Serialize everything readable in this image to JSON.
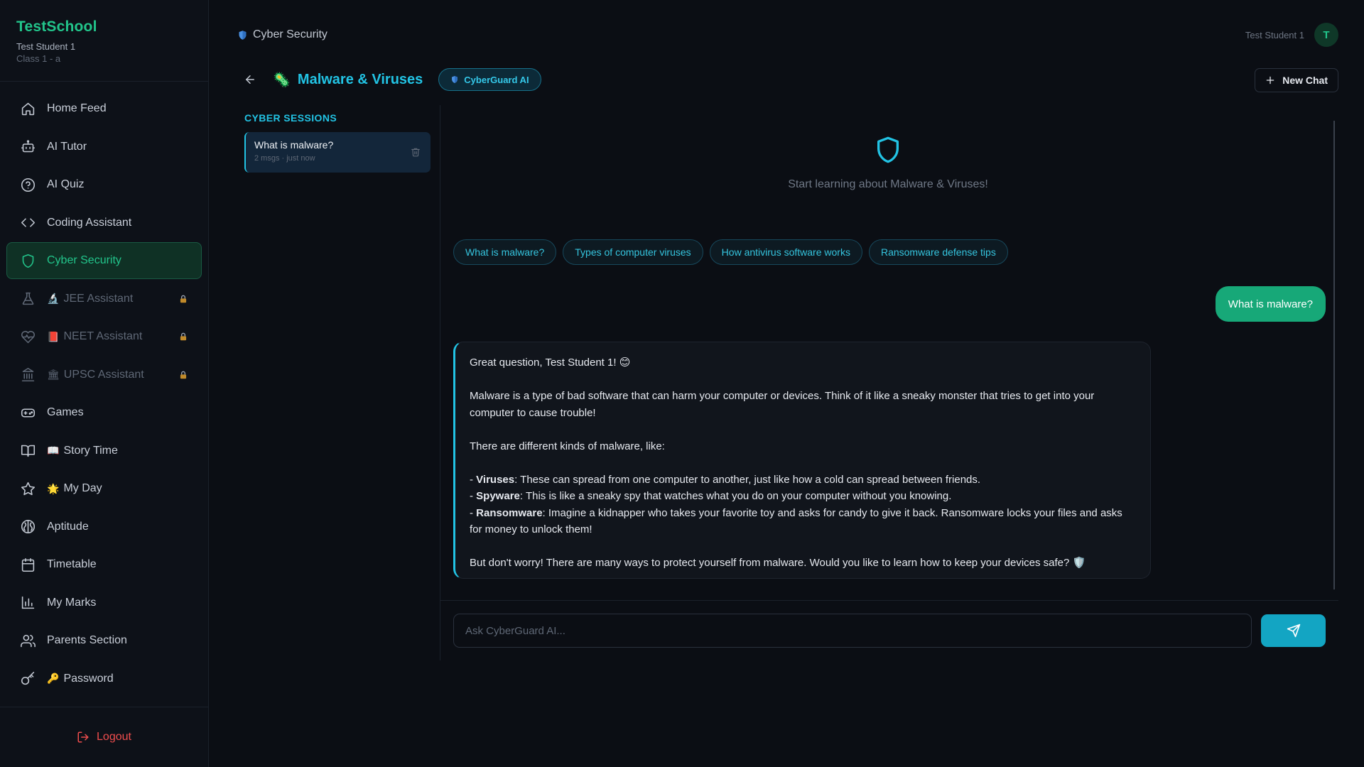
{
  "brand": {
    "name": "TestSchool",
    "user": "Test Student 1",
    "class": "Class 1 - a"
  },
  "sidebar": {
    "items": [
      {
        "label": "Home Feed",
        "emoji": "",
        "icon": "home-icon",
        "active": false,
        "locked": false
      },
      {
        "label": "AI Tutor",
        "emoji": "",
        "icon": "robot-icon",
        "active": false,
        "locked": false
      },
      {
        "label": "AI Quiz",
        "emoji": "",
        "icon": "help-circle-icon",
        "active": false,
        "locked": false
      },
      {
        "label": "Coding Assistant",
        "emoji": "",
        "icon": "code-icon",
        "active": false,
        "locked": false
      },
      {
        "label": "Cyber Security",
        "emoji": "",
        "icon": "shield-icon",
        "active": true,
        "locked": false
      },
      {
        "label": "JEE Assistant",
        "emoji": "🔬",
        "icon": "flask-icon",
        "active": false,
        "locked": true
      },
      {
        "label": "NEET Assistant",
        "emoji": "📕",
        "icon": "heart-pulse-icon",
        "active": false,
        "locked": true
      },
      {
        "label": "UPSC Assistant",
        "emoji": "🏛",
        "icon": "landmark-icon",
        "active": false,
        "locked": true
      },
      {
        "label": "Games",
        "emoji": "",
        "icon": "gamepad-icon",
        "active": false,
        "locked": false
      },
      {
        "label": "Story Time",
        "emoji": "📖",
        "icon": "book-icon",
        "active": false,
        "locked": false
      },
      {
        "label": "My Day",
        "emoji": "🌟",
        "icon": "star-icon",
        "active": false,
        "locked": false
      },
      {
        "label": "Aptitude",
        "emoji": "",
        "icon": "brain-icon",
        "active": false,
        "locked": false
      },
      {
        "label": "Timetable",
        "emoji": "",
        "icon": "calendar-icon",
        "active": false,
        "locked": false
      },
      {
        "label": "My Marks",
        "emoji": "",
        "icon": "bar-chart-icon",
        "active": false,
        "locked": false
      },
      {
        "label": "Parents Section",
        "emoji": "",
        "icon": "users-icon",
        "active": false,
        "locked": false
      },
      {
        "label": "Password",
        "emoji": "🔑",
        "icon": "key-icon",
        "active": false,
        "locked": false
      }
    ],
    "logout_label": "Logout"
  },
  "header": {
    "breadcrumb": "Cyber Security",
    "user_name": "Test Student 1",
    "avatar_initial": "T",
    "topic_emoji": "🦠",
    "topic_title": "Malware & Viruses",
    "ai_badge": "CyberGuard AI",
    "new_chat_label": "New Chat"
  },
  "sessions": {
    "title": "CYBER SESSIONS",
    "items": [
      {
        "title": "What is malware?",
        "meta": "2 msgs · just now"
      }
    ]
  },
  "chat": {
    "empty_text": "Start learning about Malware & Viruses!",
    "suggestions": [
      "What is malware?",
      "Types of computer viruses",
      "How antivirus software works",
      "Ransomware defense tips"
    ],
    "user_message": "What is malware?",
    "ai_message": {
      "greeting": "Great question, Test Student 1! 😊",
      "para1": "Malware is a type of bad software that can harm your computer or devices. Think of it like a sneaky monster that tries to get into your computer to cause trouble!",
      "para2": "There are different kinds of malware, like:",
      "bullets": [
        {
          "term": "Viruses",
          "text": ": These can spread from one computer to another, just like how a cold can spread between friends."
        },
        {
          "term": "Spyware",
          "text": ": This is like a sneaky spy that watches what you do on your computer without you knowing."
        },
        {
          "term": "Ransomware",
          "text": ": Imagine a kidnapper who takes your favorite toy and asks for candy to give it back. Ransomware locks your files and asks for money to unlock them!"
        }
      ],
      "closing": "But don't worry! There are many ways to protect yourself from malware. Would you like to learn how to keep your devices safe? 🛡️"
    },
    "input_placeholder": "Ask CyberGuard AI..."
  },
  "colors": {
    "brand_green": "#22c58b",
    "accent_cyan": "#22c3e4",
    "danger": "#ef4d4d",
    "background": "#0b0e14"
  }
}
